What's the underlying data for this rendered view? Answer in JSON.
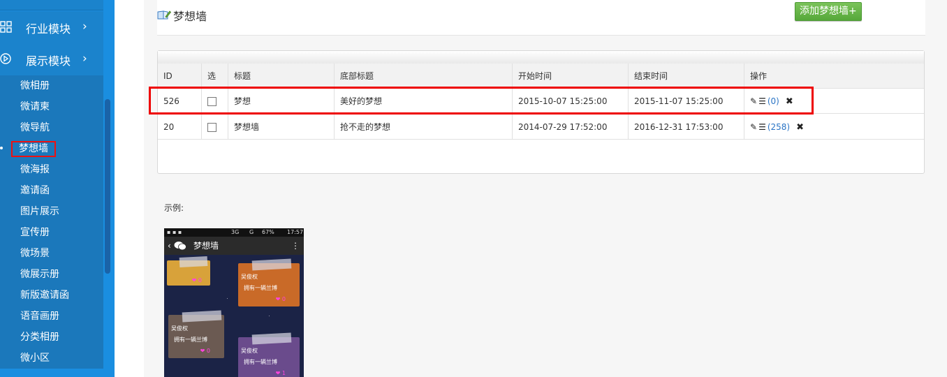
{
  "sidebar": {
    "sections": [
      {
        "label": "行业模块",
        "chevron": "›",
        "icon": "grid-icon"
      },
      {
        "label": "展示模块",
        "chevron": "›",
        "icon": "play-circle-icon"
      }
    ],
    "items": [
      "微相册",
      "微请柬",
      "微导航",
      "梦想墙",
      "微海报",
      "邀请函",
      "图片展示",
      "宣传册",
      "微场景",
      "微展示册",
      "新版邀请函",
      "语音画册",
      "分类相册",
      "微小区"
    ],
    "active_item": "梦想墙"
  },
  "page": {
    "title": "梦想墙",
    "add_button": "添加梦想墙+"
  },
  "table": {
    "headers": [
      "ID",
      "选",
      "标题",
      "底部标题",
      "开始时间",
      "结束时间",
      "操作"
    ],
    "rows": [
      {
        "id": "526",
        "title": "梦想",
        "bottom_title": "美好的梦想",
        "start": "2015-10-07 15:25:00",
        "end": "2015-11-07 15:25:00",
        "count": "(0)"
      },
      {
        "id": "20",
        "title": "梦想墙",
        "bottom_title": "抢不走的梦想",
        "start": "2014-07-29 17:52:00",
        "end": "2016-12-31 17:53:00",
        "count": "(258)"
      }
    ]
  },
  "example": {
    "label": "示例:",
    "phone": {
      "status_time": "17:57",
      "status_battery": "67%",
      "status_network": "3G",
      "status_signal": "G",
      "nav_title": "梦想墙",
      "notes": [
        {
          "name": "",
          "text": "",
          "likes": "0",
          "color": "#d8a23a"
        },
        {
          "name": "吴俊权",
          "text": "拥有一辆兰博",
          "likes": "0",
          "color": "#c96a28"
        },
        {
          "name": "吴俊权",
          "text": "拥有一辆兰博",
          "likes": "0",
          "color": "#6b5a52"
        },
        {
          "name": "吴俊权",
          "text": "拥有一辆兰博",
          "likes": "1",
          "color": "#6a4b8c"
        }
      ]
    }
  },
  "colors": {
    "sidebar": "#1a8ee0",
    "submenu": "#1b78bb",
    "highlight": "#e00000",
    "add_button": "#5fb043",
    "link": "#2a74c5"
  }
}
